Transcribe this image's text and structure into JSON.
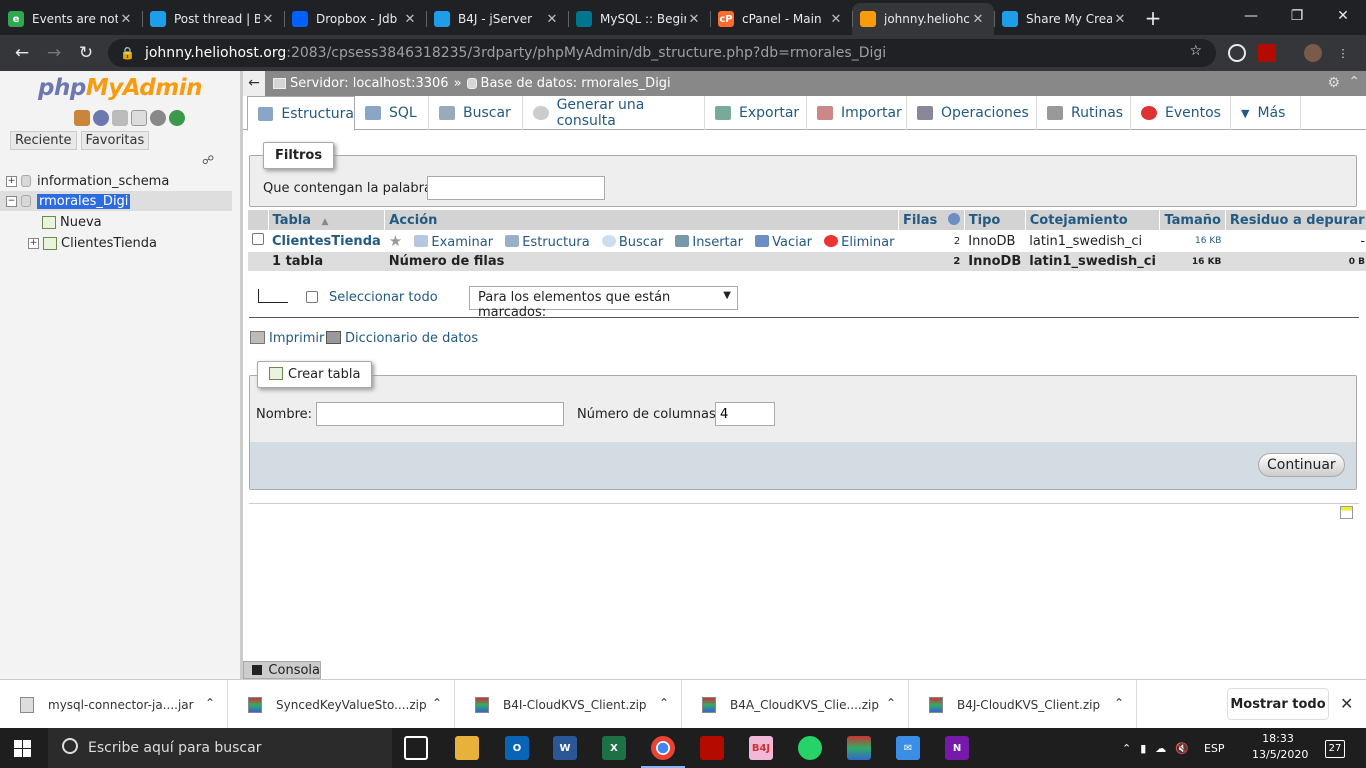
{
  "browser": {
    "tabs": [
      {
        "title": "Events are not",
        "color": "#2fa84f",
        "glyph": "e"
      },
      {
        "title": "Post thread | B",
        "color": "#1e9ee8",
        "glyph": ""
      },
      {
        "title": "Dropbox - Jdb",
        "color": "#0061ff",
        "glyph": ""
      },
      {
        "title": "B4J - jServer",
        "color": "#1e9ee8",
        "glyph": ""
      },
      {
        "title": "MySQL :: Begir",
        "color": "#00758f",
        "glyph": ""
      },
      {
        "title": "cPanel - Main",
        "color": "#ff6c2c",
        "glyph": "cP"
      },
      {
        "title": "johnny.heliohc",
        "color": "#f89c0e",
        "glyph": ""
      },
      {
        "title": "Share My Crea",
        "color": "#1e9ee8",
        "glyph": ""
      }
    ],
    "url_host": "johnny.heliohost.org",
    "url_rest": ":2083/cpsess3846318235/3rdparty/phpMyAdmin/db_structure.php?db=rmorales_Digi"
  },
  "nav": {
    "logo_php": "php",
    "logo_myadmin": "MyAdmin",
    "tab_recent": "Reciente",
    "tab_favorites": "Favoritas",
    "tree": {
      "db1": "information_schema",
      "db2": "rmorales_Digi",
      "new": "Nueva",
      "table1": "ClientesTienda"
    }
  },
  "crumb": {
    "server": "Servidor: localhost:3306",
    "sep": "»",
    "database": "Base de datos: rmorales_Digi"
  },
  "menu": [
    "Estructura",
    "SQL",
    "Buscar",
    "Generar una consulta",
    "Exportar",
    "Importar",
    "Operaciones",
    "Rutinas",
    "Eventos",
    "Más"
  ],
  "filters": {
    "legend": "Filtros",
    "label": "Que contengan la palabra:",
    "value": ""
  },
  "table": {
    "headers": {
      "tabla": "Tabla",
      "sort": "▲",
      "accion": "Acción",
      "filas": "Filas",
      "tipo": "Tipo",
      "cotejamiento": "Cotejamiento",
      "tamano": "Tamaño",
      "residuo": "Residuo a depurar"
    },
    "row": {
      "name": "ClientesTienda",
      "actions": {
        "examinar": "Examinar",
        "estructura": "Estructura",
        "buscar": "Buscar",
        "insertar": "Insertar",
        "vaciar": "Vaciar",
        "eliminar": "Eliminar"
      },
      "filas": "2",
      "tipo": "InnoDB",
      "cotejamiento": "latin1_swedish_ci",
      "tamano": "16 KB",
      "residuo": "-"
    },
    "footer": {
      "count": "1 tabla",
      "label": "Número de filas",
      "filas": "2",
      "tipo": "InnoDB",
      "cotejamiento": "latin1_swedish_ci",
      "tamano": "16 KB",
      "residuo": "0 B"
    }
  },
  "bulk": {
    "select_all": "Seleccionar todo",
    "with_selected": "Para los elementos que están marcados:"
  },
  "links": {
    "print": "Imprimir",
    "dictionary": "Diccionario de datos"
  },
  "create": {
    "legend": "Crear tabla",
    "name_label": "Nombre:",
    "name_value": "",
    "cols_label": "Número de columnas:",
    "cols_value": "4",
    "submit": "Continuar"
  },
  "console": "Consola",
  "downloads": [
    "mysql-connector-ja....jar",
    "SyncedKeyValueSto....zip",
    "B4I-CloudKVS_Client.zip",
    "B4A_CloudKVS_Clie....zip",
    "B4J-CloudKVS_Client.zip"
  ],
  "show_all": "Mostrar todo",
  "taskbar": {
    "search_placeholder": "Escribe aquí para buscar",
    "lang": "ESP",
    "time": "18:33",
    "date": "13/5/2020",
    "notifications": "27"
  }
}
